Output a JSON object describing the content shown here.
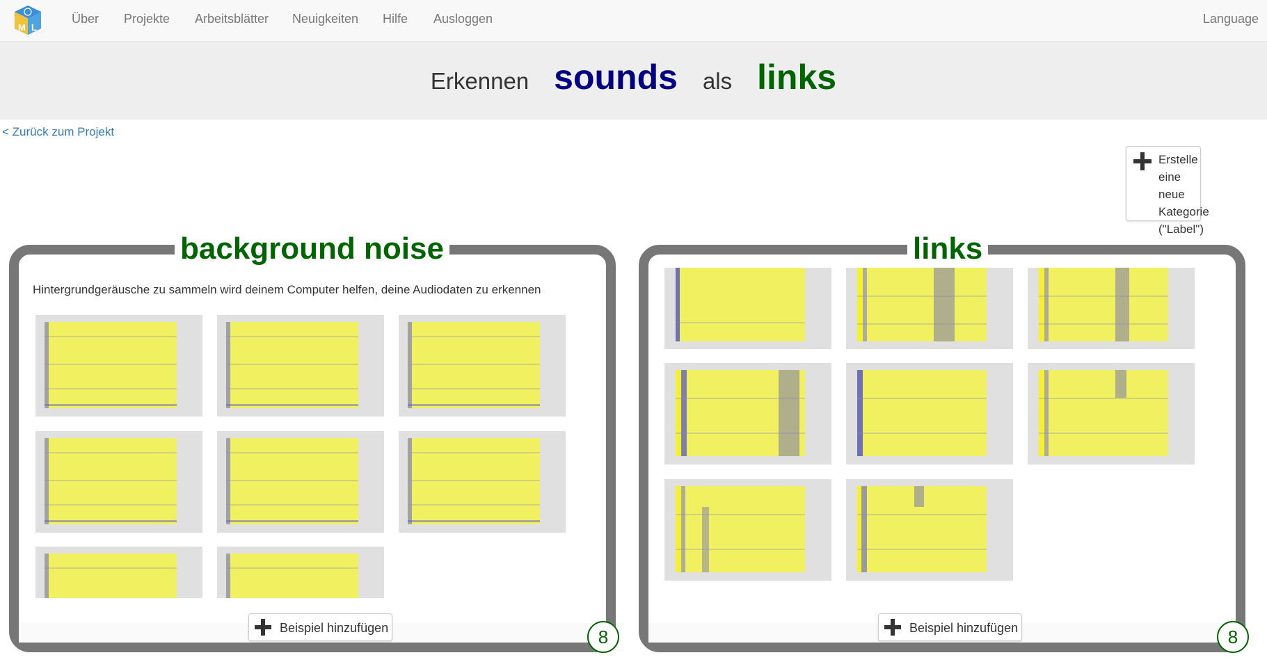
{
  "nav": {
    "items": [
      "Über",
      "Projekte",
      "Arbeitsblätter",
      "Neuigkeiten",
      "Hilfe",
      "Ausloggen"
    ],
    "language": "Language"
  },
  "title": {
    "prefix": "Erkennen",
    "data_type": "sounds",
    "middle": "als",
    "target": "links"
  },
  "back_link": "< Zurück zum Projekt",
  "new_label_button": "Erstelle eine neue Kategorie (\"Label\")",
  "labels": [
    {
      "name": "background noise",
      "description": "Hintergrundgeräusche zu sammeln wird deinem Computer helfen, deine Audiodaten zu erkennen",
      "count": "8",
      "add_button": "Beispiel hinzufügen"
    },
    {
      "name": "links",
      "description": "",
      "count": "8",
      "add_button": "Beispiel hinzufügen"
    }
  ],
  "colors": {
    "spectrogram_bg": "#f0f060",
    "spectrogram_fg": "#5050d0",
    "label_green": "#006400",
    "title_blue": "#000080"
  },
  "icons": [
    "logo-icon",
    "plus-icon"
  ]
}
